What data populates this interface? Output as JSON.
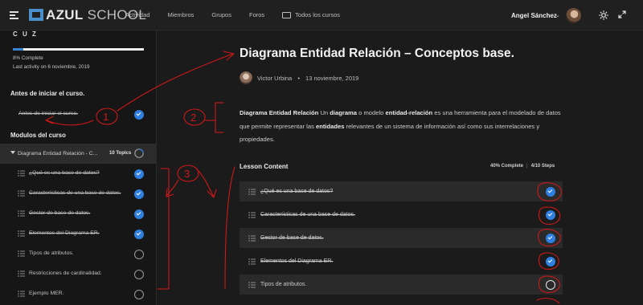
{
  "header": {
    "logo_bold": "AZUL",
    "logo_light": "SCHOOL",
    "nav": [
      "Actividad",
      "Miembros",
      "Grupos",
      "Foros",
      "Todos los cursos"
    ],
    "user_name": "Angel Sánchez",
    "caret": "⌄"
  },
  "sidebar": {
    "cut_title": "C U Z",
    "progress_pct": 8,
    "complete_text": "8% Complete",
    "last_activity": "Last activity on 6 noviembre, 2019",
    "section1_title": "Antes de iniciar el curso.",
    "section1_item": "Antes de iniciar el curso.",
    "section2_title": "Modulos del curso",
    "module_label": "Diagrama Entidad Relación - C...",
    "module_topics": "10 Topics",
    "items": [
      {
        "label": "¿Qué es una base de datos?",
        "done": true
      },
      {
        "label": "Características de una base de datos.",
        "done": true
      },
      {
        "label": "Gestor de base de datos.",
        "done": true
      },
      {
        "label": "Elementos del Diagrama ER.",
        "done": true
      },
      {
        "label": "Tipos de atributos.",
        "done": false
      },
      {
        "label": "Restricciones de cardinalidad.",
        "done": false
      },
      {
        "label": "Ejemplo MER.",
        "done": false
      }
    ]
  },
  "main": {
    "title": "Diagrama Entidad Relación – Conceptos base.",
    "author": "Victor Urbina",
    "date": "13 noviembre, 2019",
    "bullet": "•",
    "desc_b1": "Diagrama Entidad Relación",
    "desc_t1": " Un ",
    "desc_b2": "diagrama",
    "desc_t2": " o modelo ",
    "desc_b3": "entidad-relación",
    "desc_t3": " es una herramienta para el modelado de datos que permite representar las ",
    "desc_b4": "entidades",
    "desc_t4": " relevantes de un sistema de información así como sus interrelaciones y propiedades.",
    "lesson_content": "Lesson Content",
    "complete": "40% Complete",
    "steps": "4/10 Steps",
    "sep": "|",
    "lessons": [
      {
        "label": "¿Qué es una base de datos?",
        "done": true
      },
      {
        "label": "Características de una base de datos.",
        "done": true
      },
      {
        "label": "Gestor de base de datos.",
        "done": true
      },
      {
        "label": "Elementos del Diagrama ER.",
        "done": true
      },
      {
        "label": "Tipos de atributos.",
        "done": false
      }
    ]
  },
  "annotations": {
    "n1": "1",
    "n2": "2",
    "n3": "3",
    "color": "#d01818"
  }
}
